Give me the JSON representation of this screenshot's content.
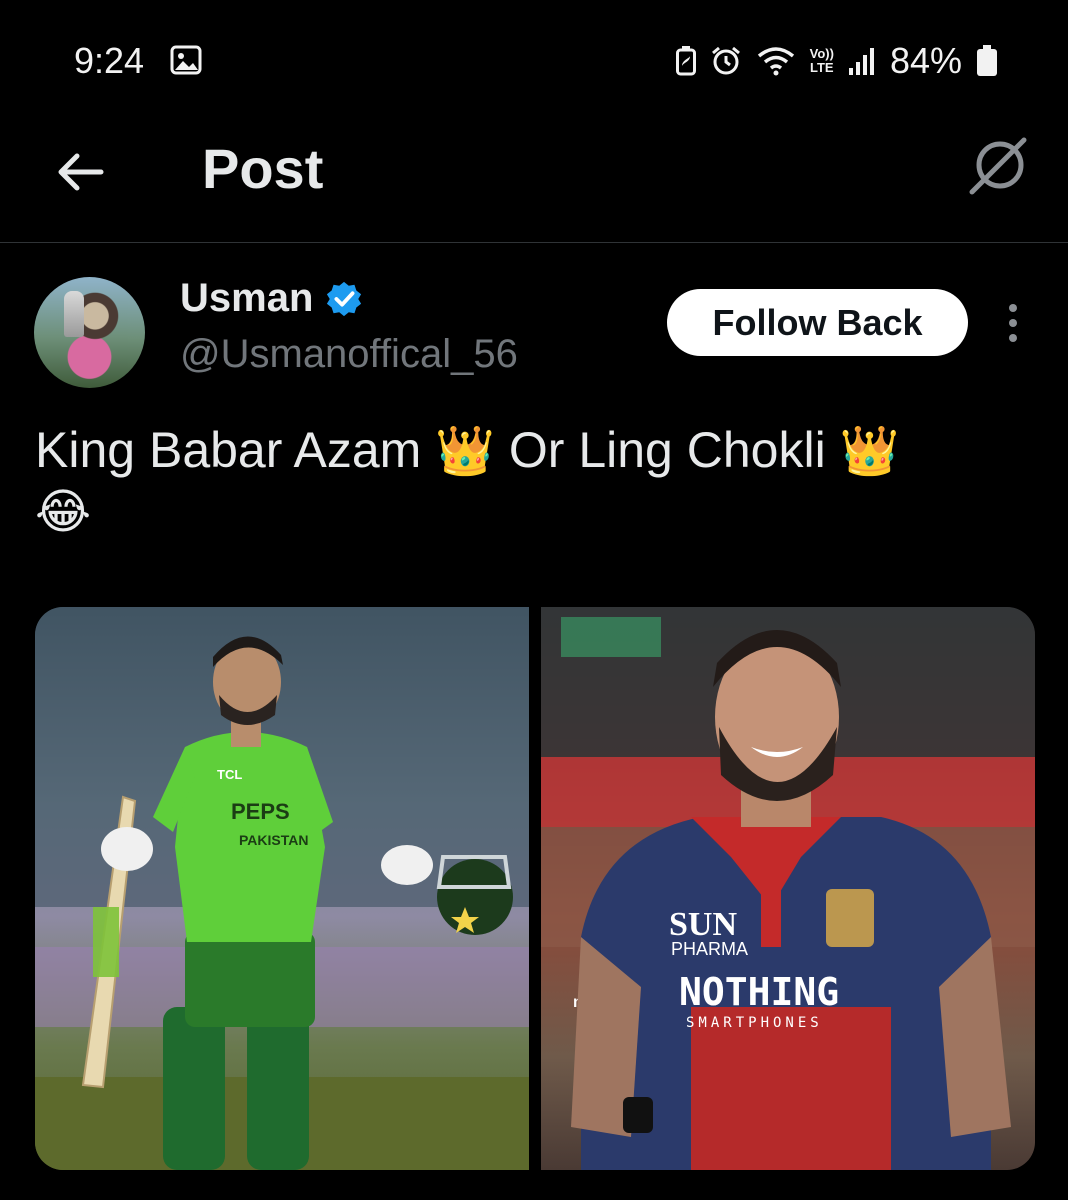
{
  "status_bar": {
    "time": "9:24",
    "volte_line1": "Vo))",
    "volte_line2": "LTE",
    "battery_percent": "84%",
    "icons": [
      "gallery-icon",
      "battery-saver-icon",
      "alarm-icon",
      "wifi-icon",
      "volte-icon",
      "signal-icon",
      "battery-icon"
    ]
  },
  "header": {
    "title": "Post",
    "back_icon": "arrow-left-icon",
    "grok_icon": "grok-icon"
  },
  "post": {
    "author": {
      "name": "Usman",
      "handle": "@Usmanoffical_56",
      "verified": true
    },
    "follow_label": "Follow Back",
    "text_line1_a": "King Babar Azam ",
    "emoji_crown": "👑",
    "text_line1_b": " Or Ling Chokli ",
    "emoji_laugh": "😂",
    "media": [
      {
        "subject": "cricketer-green-kit",
        "jersey_sponsor": "PEPS",
        "jersey_team": "PAKISTAN",
        "chest_logo": "TCL"
      },
      {
        "subject": "cricketer-red-blue-kit",
        "sponsor_1": "SUN",
        "sponsor_2": "PHARMA",
        "front_text": "NOTHING",
        "front_sub": "SMARTPHONES",
        "sleeve_text": "mdkt"
      }
    ]
  },
  "colors": {
    "background": "#000000",
    "text_primary": "#e7e9ea",
    "text_secondary": "#71767b",
    "verified_blue": "#1d9bf0",
    "divider": "#2f3336"
  }
}
